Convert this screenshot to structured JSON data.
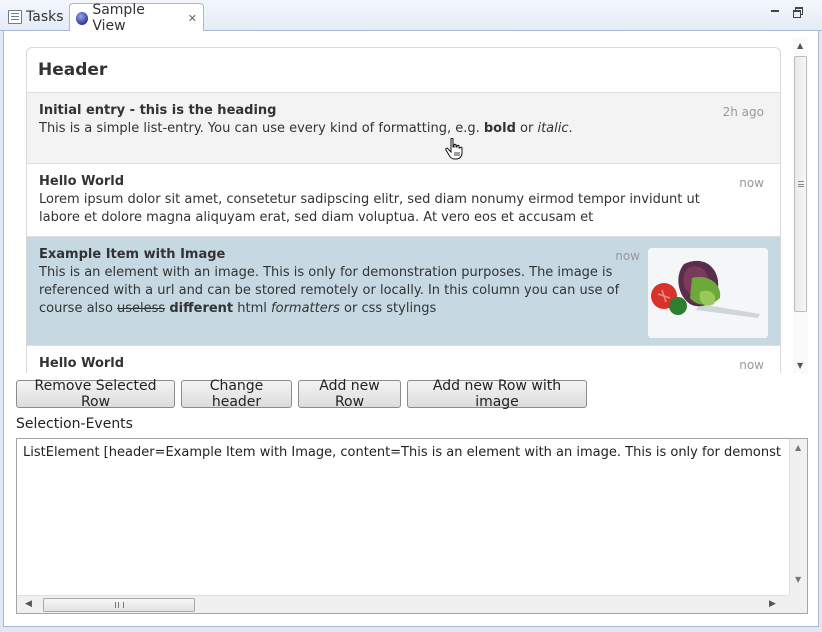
{
  "tabs": [
    {
      "label": "Tasks",
      "icon": "tasks-icon"
    },
    {
      "label": "Sample View",
      "icon": "view-icon",
      "close": "✕"
    }
  ],
  "list": {
    "header": "Header",
    "items": [
      {
        "title": "Initial entry - this is the heading",
        "time": "2h ago",
        "body_a": "This is a simple list-entry. You can use every kind of formatting, e.g. ",
        "body_bold": "bold",
        "body_b": " or ",
        "body_italic": "italic",
        "body_c": "."
      },
      {
        "title": "Hello World",
        "time": "now",
        "body": "Lorem ipsum dolor sit amet, consetetur sadipscing elitr, sed diam nonumy eirmod tempor invidunt ut labore et dolore magna aliquyam erat, sed diam voluptua. At vero eos et accusam et"
      },
      {
        "title": "Example Item with Image",
        "time": "now",
        "body_a": "This is an element with an image. This is only for demonstration purposes. The image is referenced with a url and can be stored remotely or locally. In this column you can use of course also ",
        "body_strike": "useless",
        "body_bold": "different",
        "body_b": " html ",
        "body_italic": "formatters",
        "body_c": " or css stylings"
      },
      {
        "title": "Hello World",
        "time": "now"
      }
    ]
  },
  "buttons": {
    "remove": "Remove Selected Row",
    "change_header": "Change header",
    "add_row": "Add new Row",
    "add_row_image": "Add new Row with image"
  },
  "selection": {
    "label": "Selection-Events",
    "text": "ListElement [header=Example Item with Image, content=This is an element with an image. This is only for demonst"
  }
}
